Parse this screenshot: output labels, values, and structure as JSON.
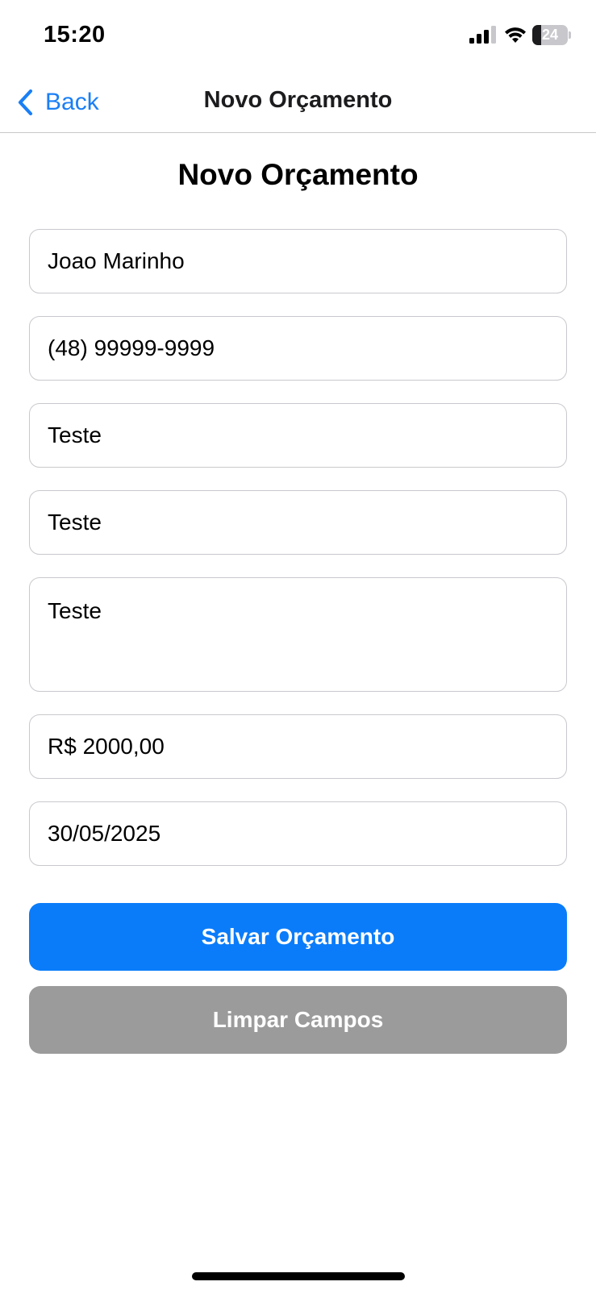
{
  "status_bar": {
    "time": "15:20",
    "battery_level": "24",
    "battery_fraction": 0.24
  },
  "nav": {
    "back_label": "Back",
    "title": "Novo Orçamento"
  },
  "page": {
    "heading": "Novo Orçamento"
  },
  "form": {
    "client_name": "Joao Marinho",
    "phone": "(48) 99999-9999",
    "field_3": "Teste",
    "field_4": "Teste",
    "description": "Teste",
    "value": "R$ 2000,00",
    "date": "30/05/2025"
  },
  "actions": {
    "save_label": "Salvar Orçamento",
    "clear_label": "Limpar Campos"
  },
  "colors": {
    "accent": "#0a7cfa",
    "back_link": "#1a7ff5",
    "secondary_button": "#9b9b9b",
    "field_border": "#c9c9ce"
  }
}
